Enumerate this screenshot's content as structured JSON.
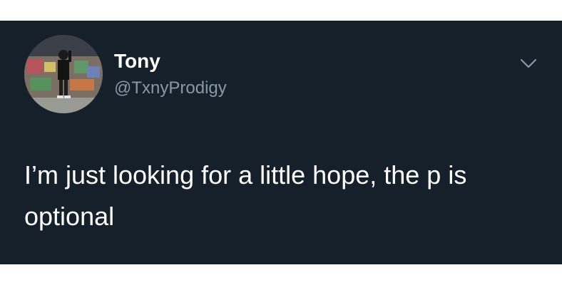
{
  "tweet": {
    "display_name": "Tony",
    "handle": "@TxnyProdigy",
    "text": "I’m just looking for a little hope, the p is optional"
  },
  "icons": {
    "avatar": "profile-photo",
    "menu": "chevron-down-icon"
  },
  "colors": {
    "background": "#15202b",
    "text": "#ffffff",
    "secondary_text": "#8899a6"
  }
}
